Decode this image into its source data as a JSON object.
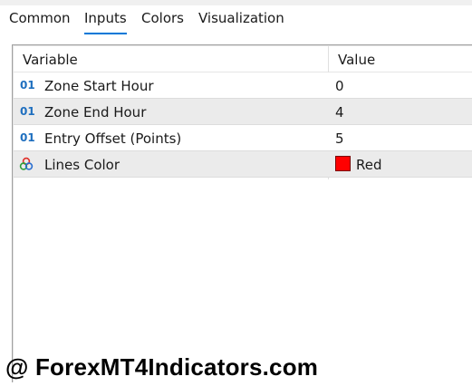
{
  "tabs": [
    {
      "label": "Common"
    },
    {
      "label": "Inputs"
    },
    {
      "label": "Colors"
    },
    {
      "label": "Visualization"
    }
  ],
  "active_tab": "Inputs",
  "table": {
    "headers": {
      "variable": "Variable",
      "value": "Value"
    },
    "rows": [
      {
        "icon": "integer-param-icon",
        "icon_text": "01",
        "variable": "Zone Start Hour",
        "value": "0"
      },
      {
        "icon": "integer-param-icon",
        "icon_text": "01",
        "variable": "Zone End Hour",
        "value": "4"
      },
      {
        "icon": "integer-param-icon",
        "icon_text": "01",
        "variable": "Entry Offset (Points)",
        "value": "5"
      },
      {
        "icon": "color-param-icon",
        "variable": "Lines Color",
        "value": "Red",
        "color": "#ff0000"
      }
    ]
  },
  "watermark": "@ ForexMT4Indicators.com",
  "colors": {
    "accent": "#0078d7",
    "row_alt": "#ebebeb",
    "icon_blue": "#1f6fbf"
  }
}
